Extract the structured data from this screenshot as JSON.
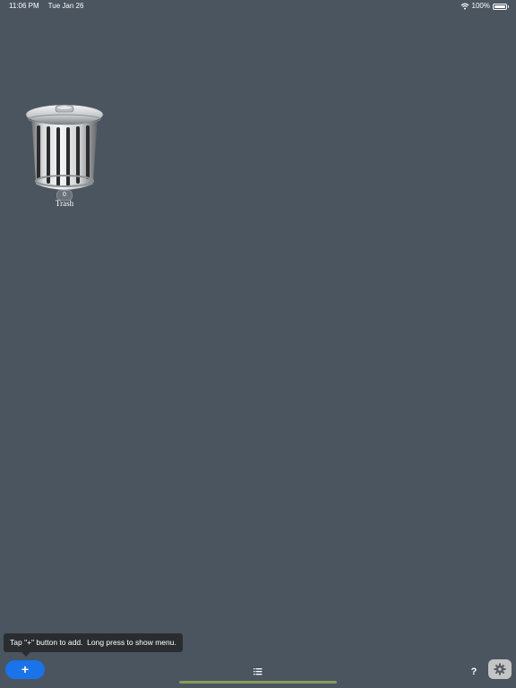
{
  "status_bar": {
    "time": "11:06 PM",
    "date": "Tue Jan 26",
    "battery": "100%"
  },
  "desktop": {
    "items": [
      {
        "label": "Trash",
        "count": "0",
        "icon": "trash-can-icon"
      }
    ]
  },
  "tooltip": {
    "text": "Tap \"+\" button to add.  Long press to show menu."
  },
  "toolbar": {
    "add_label": "+",
    "list_icon": "list-icon",
    "help_label": "?",
    "settings_icon": "gear-icon"
  },
  "colors": {
    "background": "#4a5560",
    "accent": "#1a73e8",
    "tooltip_bg": "#2a2d30",
    "home_indicator": "#8a9a5a"
  }
}
